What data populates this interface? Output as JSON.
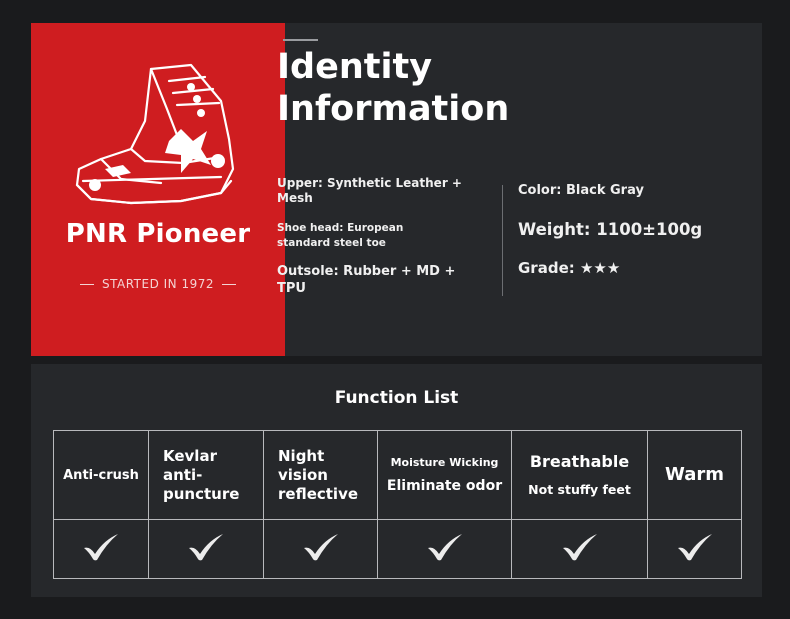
{
  "brand": {
    "name": "PNR Pioneer",
    "tagline": "STARTED IN 1972"
  },
  "identity": {
    "title_line1": "Identity",
    "title_line2": "Information",
    "upper_line1": "Upper: Synthetic Leather +",
    "upper_line2": "Mesh",
    "shoe_head_line1": "Shoe head: European",
    "shoe_head_line2": "standard steel toe",
    "outsole": "Outsole: Rubber + MD + TPU",
    "color": "Color: Black Gray",
    "weight": "Weight: 1100±100g",
    "grade": "Grade: ★★★"
  },
  "functions": {
    "title": "Function List",
    "columns": [
      {
        "lines": [
          "Anti-crush"
        ]
      },
      {
        "lines": [
          "Kevlar",
          "anti-",
          "puncture"
        ]
      },
      {
        "lines": [
          "Night",
          "vision",
          "reflective"
        ]
      },
      {
        "lines": [
          "Moisture Wicking",
          "Eliminate odor"
        ]
      },
      {
        "lines": [
          "Breathable",
          "Not stuffy feet"
        ]
      },
      {
        "lines": [
          "Warm"
        ]
      }
    ]
  },
  "icons": {
    "check": "check-mark-icon",
    "boot": "boot-illustration"
  },
  "colors": {
    "brand_red": "#cf1d20",
    "panel": "#26282b",
    "background": "#1a1b1d",
    "text": "#ffffff"
  }
}
